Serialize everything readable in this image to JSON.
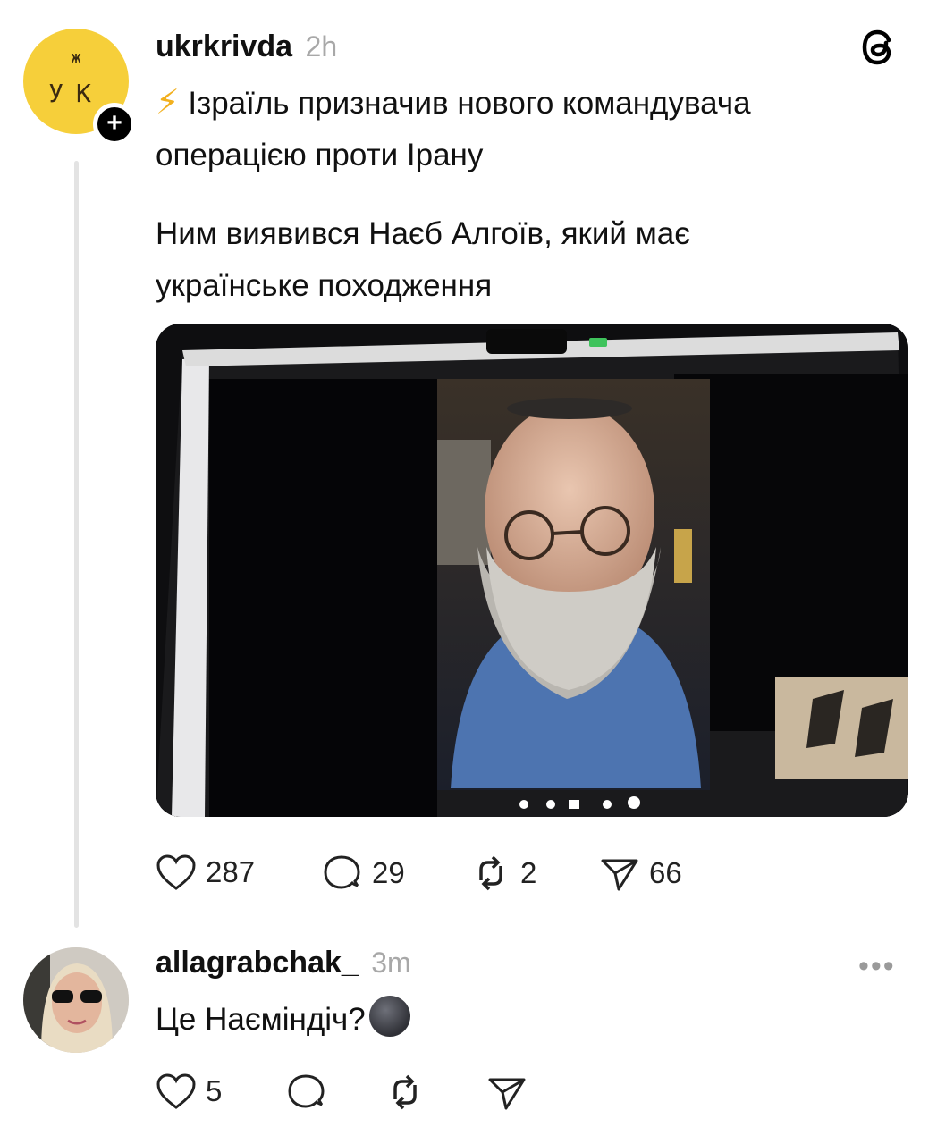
{
  "post": {
    "avatar_top": "ж",
    "avatar_bottom": "УК",
    "username": "ukrkrivda",
    "time": "2h",
    "line1_emoji": "⚡",
    "line1": "Ізраїль призначив нового командувача",
    "line2": "операцією проти Ірану",
    "line3": "Ним виявився Наєб Алгоїв, який має",
    "line4": "українське походження",
    "likes": "287",
    "comments": "29",
    "reposts": "2",
    "shares": "66"
  },
  "reply": {
    "username": "allagrabchak_",
    "time": "3m",
    "text": "Це Наєміндіч?",
    "likes": "5"
  },
  "icons": {
    "threads": "threads-logo-icon",
    "follow": "plus-icon",
    "like": "heart-icon",
    "comment": "comment-bubble-icon",
    "repost": "repost-icon",
    "share": "send-icon",
    "more": "more-dots-icon",
    "emoji": "new-moon-face-emoji"
  },
  "colors": {
    "avatar_bg": "#f6cf3a",
    "muted": "#a8a8a8",
    "thread_line": "#e3e3e3"
  }
}
